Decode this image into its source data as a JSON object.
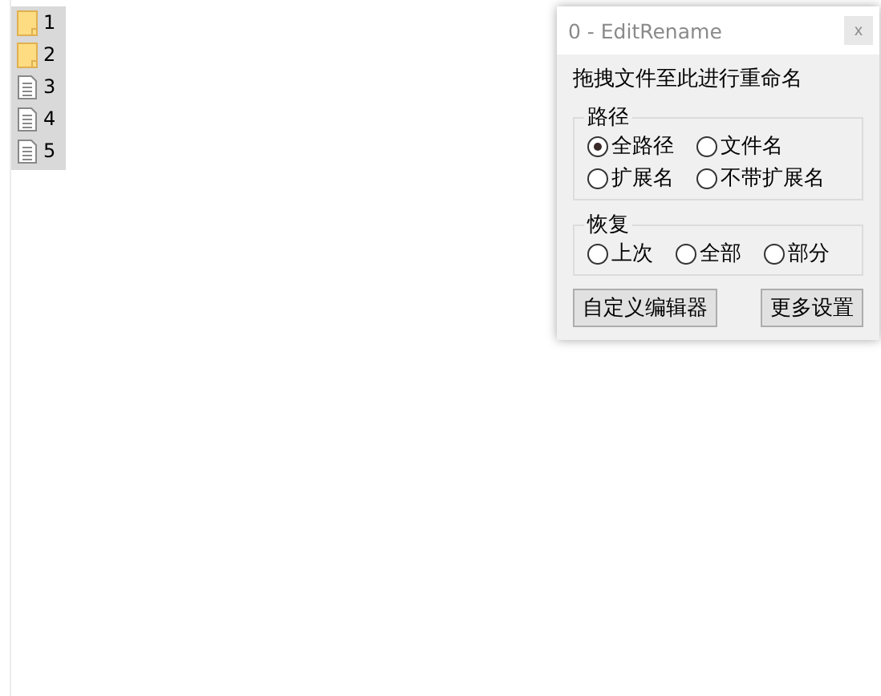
{
  "files": [
    {
      "name": "1",
      "kind": "folder"
    },
    {
      "name": "2",
      "kind": "folder"
    },
    {
      "name": "3",
      "kind": "file"
    },
    {
      "name": "4",
      "kind": "file"
    },
    {
      "name": "5",
      "kind": "file"
    }
  ],
  "window": {
    "title": "0 - EditRename",
    "close": "x"
  },
  "instruction": "拖拽文件至此进行重命名",
  "groups": [
    {
      "legend": "路径",
      "options": [
        {
          "label": "全路径",
          "selected": true
        },
        {
          "label": "文件名",
          "selected": false
        },
        {
          "label": "扩展名",
          "selected": false
        },
        {
          "label": "不带扩展名",
          "selected": false
        }
      ]
    },
    {
      "legend": "恢复",
      "options": [
        {
          "label": "上次",
          "selected": false
        },
        {
          "label": "全部",
          "selected": false
        },
        {
          "label": "部分",
          "selected": false
        }
      ]
    }
  ],
  "buttons": [
    "自定义编辑器",
    "更多设置"
  ]
}
